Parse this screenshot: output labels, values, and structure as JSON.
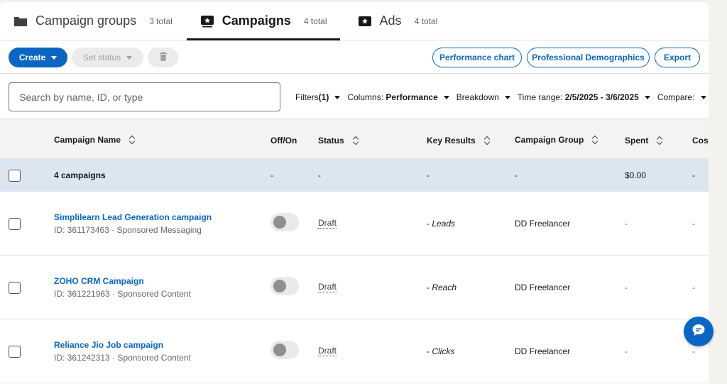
{
  "tabs": [
    {
      "label": "Campaign groups",
      "count": "3 total",
      "icon": "folder-icon"
    },
    {
      "label": "Campaigns",
      "count": "4 total",
      "icon": "campaign-icon"
    },
    {
      "label": "Ads",
      "count": "4 total",
      "icon": "ad-icon"
    }
  ],
  "toolbar": {
    "create_label": "Create",
    "set_status_label": "Set status",
    "performance_chart_label": "Performance chart",
    "demographics_label": "Professional Demographics",
    "export_label": "Export"
  },
  "search": {
    "placeholder": "Search by name, ID, or type"
  },
  "filters": {
    "filters_label": "Filters",
    "filters_count": "(1)",
    "columns_label": "Columns:",
    "columns_value": "Performance",
    "breakdown_label": "Breakdown",
    "time_range_label": "Time range:",
    "time_range_value": "2/5/2025 - 3/6/2025",
    "compare_label": "Compare:"
  },
  "table": {
    "headers": {
      "campaign_name": "Campaign Name",
      "off_on": "Off/On",
      "status": "Status",
      "key_results": "Key Results",
      "campaign_group": "Campaign Group",
      "spent": "Spent",
      "cost": "Cost"
    },
    "summary": {
      "label": "4 campaigns",
      "off_on": "-",
      "status": "-",
      "key_results": "-",
      "campaign_group": "-",
      "spent": "$0.00",
      "cost": "-"
    },
    "rows": [
      {
        "name": "Simplilearn Lead Generation campaign",
        "meta": "ID: 361173463 · Sponsored Messaging",
        "status": "Draft",
        "key_results": "- Leads",
        "campaign_group": "DD Freelancer",
        "spent": "-",
        "cost": "-"
      },
      {
        "name": "ZOHO CRM Campaign",
        "meta": "ID: 361221963 · Sponsored Content",
        "status": "Draft",
        "key_results": "- Reach",
        "campaign_group": "DD Freelancer",
        "spent": "-",
        "cost": "-"
      },
      {
        "name": "Reliance Jio Job campaign",
        "meta": "ID: 361242313 · Sponsored Content",
        "status": "Draft",
        "key_results": "- Clicks",
        "campaign_group": "DD Freelancer",
        "spent": "-",
        "cost": "-"
      }
    ]
  },
  "colors": {
    "brand": "#0a66c2",
    "summary_bg": "#dce6f0"
  }
}
